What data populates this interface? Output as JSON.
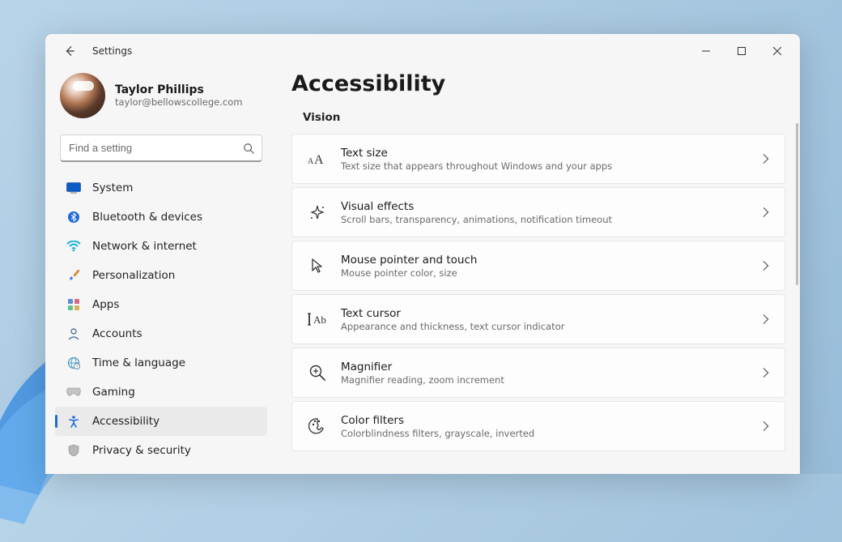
{
  "titlebar": {
    "app_name": "Settings"
  },
  "profile": {
    "name": "Taylor Phillips",
    "email": "taylor@bellowscollege.com"
  },
  "search": {
    "placeholder": "Find a setting"
  },
  "sidebar": {
    "items": [
      {
        "label": "System"
      },
      {
        "label": "Bluetooth & devices"
      },
      {
        "label": "Network & internet"
      },
      {
        "label": "Personalization"
      },
      {
        "label": "Apps"
      },
      {
        "label": "Accounts"
      },
      {
        "label": "Time & language"
      },
      {
        "label": "Gaming"
      },
      {
        "label": "Accessibility"
      },
      {
        "label": "Privacy & security"
      }
    ]
  },
  "page": {
    "title": "Accessibility",
    "section": "Vision",
    "items": [
      {
        "title": "Text size",
        "subtitle": "Text size that appears throughout Windows and your apps"
      },
      {
        "title": "Visual effects",
        "subtitle": "Scroll bars, transparency, animations, notification timeout"
      },
      {
        "title": "Mouse pointer and touch",
        "subtitle": "Mouse pointer color, size"
      },
      {
        "title": "Text cursor",
        "subtitle": "Appearance and thickness, text cursor indicator"
      },
      {
        "title": "Magnifier",
        "subtitle": "Magnifier reading, zoom increment"
      },
      {
        "title": "Color filters",
        "subtitle": "Colorblindness filters, grayscale, inverted"
      }
    ]
  }
}
